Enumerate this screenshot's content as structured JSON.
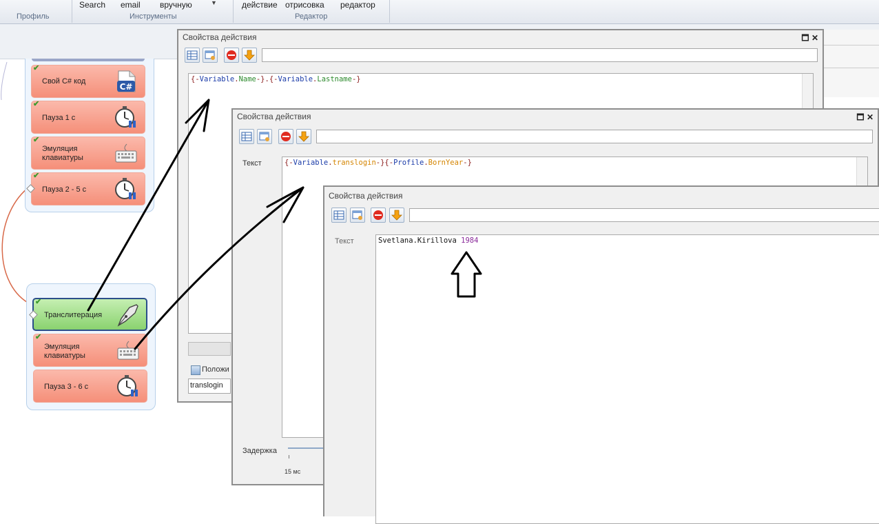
{
  "ribbon": {
    "groups": [
      {
        "label": "Профиль"
      },
      {
        "label": "Инструменты",
        "items": [
          "Search",
          "email",
          "вручную"
        ]
      },
      {
        "label": "Редактор",
        "items": [
          "действие",
          "отрисовка",
          "редактор"
        ]
      }
    ]
  },
  "flow": {
    "group1": [
      {
        "label": "Свой C# код",
        "icon": "csharp-icon"
      },
      {
        "label": "Пауза 1 с",
        "icon": "stopwatch-icon"
      },
      {
        "label": "Эмуляция клавиатуры",
        "line1": "Эмуляция",
        "line2": "клавиатуры",
        "icon": "keyboard-icon"
      },
      {
        "label": "Пауза 2 - 5 с",
        "icon": "stopwatch-icon"
      }
    ],
    "group2": [
      {
        "label": "Транслитерация",
        "icon": "pen-icon",
        "selected": true
      },
      {
        "label": "Эмуляция клавиатуры",
        "line1": "Эмуляция",
        "line2": "клавиатуры",
        "icon": "keyboard-icon"
      },
      {
        "label": "Пауза 3 - 6 с",
        "icon": "stopwatch-icon"
      }
    ]
  },
  "window1": {
    "title": "Свойства действия",
    "text": {
      "p1": "{-",
      "kw1": "Variable",
      "dot1": ".",
      "nm1": "Name",
      "p2": "-}.{-",
      "kw2": "Variable",
      "dot2": ".",
      "nm2": "Lastname",
      "p3": "-}"
    },
    "checkbox_label": "Положи",
    "field_value": "translogin"
  },
  "window2": {
    "title": "Свойства действия",
    "text_label": "Текст",
    "text": {
      "p1": "{-",
      "kw1": "Variable",
      "dot1": ".",
      "nm1": "translogin",
      "p2": "-}{-",
      "kw2": "Profile",
      "dot2": ".",
      "nm2": "BornYear",
      "p3": "-}"
    },
    "delay_label": "Задержка",
    "delay_value": "15 мс"
  },
  "window3": {
    "title": "Свойства действия",
    "text_label": "Текст",
    "result_name": "Svetlana.Kirillova",
    "result_year": "1984"
  },
  "colors": {
    "node_red": "#f58f79",
    "node_green": "#8ad26f",
    "selected_border": "#2b4e8a",
    "check": "#3c9a2c"
  }
}
